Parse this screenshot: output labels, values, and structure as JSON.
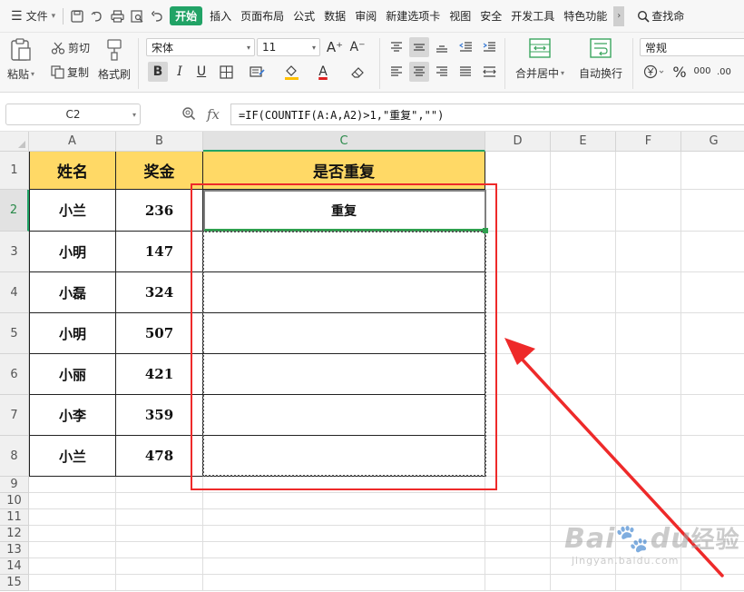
{
  "menubar": {
    "file_label": "文件",
    "tabs": [
      "插入",
      "页面布局",
      "公式",
      "数据",
      "审阅",
      "新建选项卡",
      "视图",
      "安全",
      "开发工具",
      "特色功能"
    ],
    "start_label": "开始",
    "search_label": "查找命"
  },
  "ribbon": {
    "paste_label": "粘贴",
    "cut_label": "剪切",
    "copy_label": "复制",
    "format_painter_label": "格式刷",
    "font_name": "宋体",
    "font_size": "11",
    "grow_font": "A⁺",
    "shrink_font": "A⁻",
    "bold": "B",
    "italic": "I",
    "underline": "U",
    "font_color_letter": "A",
    "merge_center_label": "合并居中",
    "wrap_text_label": "自动换行",
    "number_format": "常规",
    "percent": "%",
    "thousands": "000",
    "decimal": ".00"
  },
  "formula_bar": {
    "name_box": "C2",
    "fx": "fx",
    "formula": "=IF(COUNTIF(A:A,A2)>1,\"重复\",\"\")"
  },
  "sheet": {
    "columns": [
      "A",
      "B",
      "C",
      "D",
      "E",
      "F",
      "G"
    ],
    "rows": [
      "1",
      "2",
      "3",
      "4",
      "5",
      "6",
      "7",
      "8",
      "9",
      "10",
      "11",
      "12",
      "13",
      "14",
      "15"
    ],
    "header": {
      "name": "姓名",
      "bonus": "奖金",
      "dup": "是否重复"
    },
    "records": [
      {
        "name": "小兰",
        "bonus": "236",
        "dup": "重复"
      },
      {
        "name": "小明",
        "bonus": "147",
        "dup": ""
      },
      {
        "name": "小磊",
        "bonus": "324",
        "dup": ""
      },
      {
        "name": "小明",
        "bonus": "507",
        "dup": ""
      },
      {
        "name": "小丽",
        "bonus": "421",
        "dup": ""
      },
      {
        "name": "小李",
        "bonus": "359",
        "dup": ""
      },
      {
        "name": "小兰",
        "bonus": "478",
        "dup": ""
      }
    ],
    "selected_cell": "C2"
  },
  "colors": {
    "accent": "#21a366",
    "header_fill": "#ffd966",
    "annotation_red": "#ee2a2a"
  },
  "watermark": {
    "main_latin_1": "Bai",
    "main_cn": "经验",
    "main_latin_2": "du",
    "sub": "jingyan.baidu.com"
  }
}
